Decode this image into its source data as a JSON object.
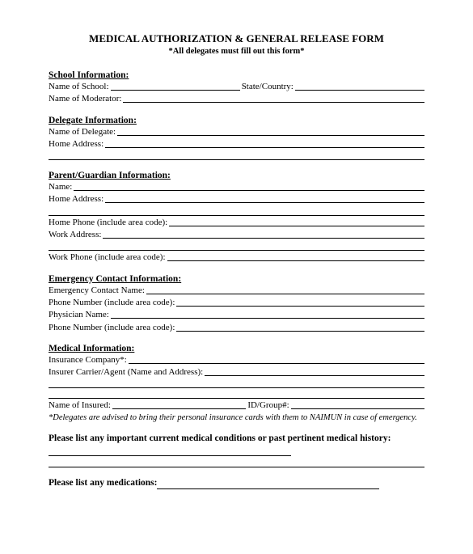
{
  "title": "MEDICAL AUTHORIZATION & GENERAL RELEASE FORM",
  "subtitle": "*All delegates must fill out this form*",
  "school": {
    "header": "School Information:",
    "name_label": "Name of School:",
    "state_label": "State/Country:",
    "moderator_label": "Name of Moderator:"
  },
  "delegate": {
    "header": "Delegate Information:",
    "name_label": "Name of Delegate:",
    "address_label": "Home Address:"
  },
  "parent": {
    "header": "Parent/Guardian Information:",
    "name_label": "Name:",
    "address_label": "Home Address:",
    "home_phone_label": "Home Phone (include area code):",
    "work_address_label": "Work Address:",
    "work_phone_label": "Work Phone (include area code):"
  },
  "emergency": {
    "header": "Emergency Contact Information:",
    "name_label": "Emergency Contact Name:",
    "phone1_label": "Phone Number (include area code):",
    "physician_label": "Physician Name:",
    "phone2_label": "Phone Number (include area code):"
  },
  "medical": {
    "header": "Medical Information:",
    "insurance_label": "Insurance Company*:",
    "carrier_label": "Insurer Carrier/Agent (Name and Address):",
    "insured_label": "Name of Insured:",
    "group_label": "ID/Group#:",
    "note": "*Delegates are advised to bring their personal insurance cards with them to NAIMUN in case of emergency."
  },
  "conditions_q": "Please list any important current medical conditions or past pertinent medical history:",
  "medications_q": "Please list any medications:"
}
